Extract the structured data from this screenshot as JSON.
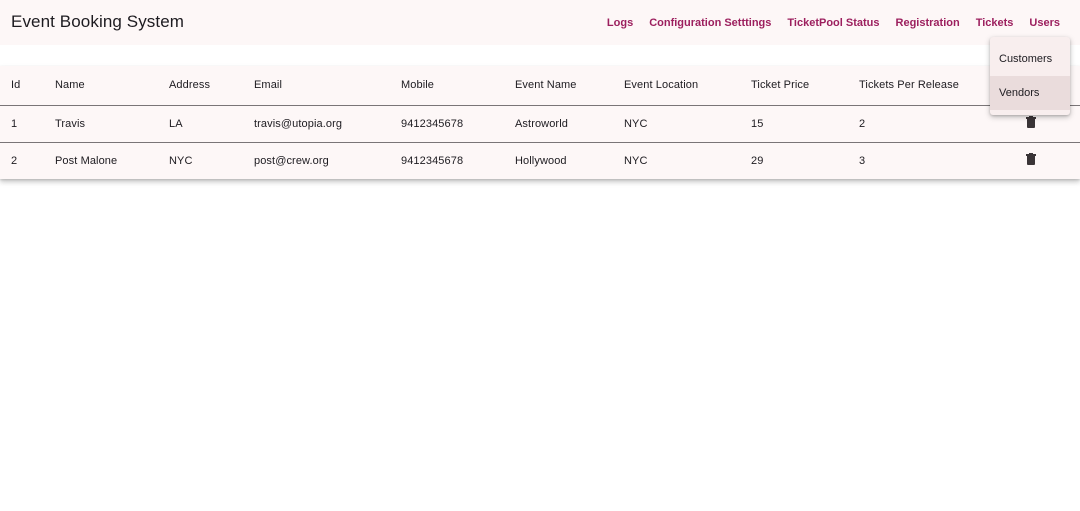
{
  "header": {
    "title": "Event Booking System",
    "nav": [
      {
        "id": "logs",
        "label": "Logs"
      },
      {
        "id": "configuration",
        "label": "Configuration Setttings"
      },
      {
        "id": "ticketpool",
        "label": "TicketPool Status"
      },
      {
        "id": "registration",
        "label": "Registration"
      },
      {
        "id": "tickets",
        "label": "Tickets"
      },
      {
        "id": "users",
        "label": "Users"
      }
    ]
  },
  "users_menu": {
    "items": [
      {
        "label": "Customers"
      },
      {
        "label": "Vendors"
      }
    ],
    "highlighted": "Vendors"
  },
  "table": {
    "columns": [
      "Id",
      "Name",
      "Address",
      "Email",
      "Mobile",
      "Event Name",
      "Event Location",
      "Ticket Price",
      "Tickets Per Release"
    ],
    "rows": [
      {
        "id": "1",
        "name": "Travis",
        "address": "LA",
        "email": "travis@utopia.org",
        "mobile": "9412345678",
        "event_name": "Astroworld",
        "event_location": "NYC",
        "ticket_price": "15",
        "tickets_per_release": "2",
        "action_icon": "delete-icon"
      },
      {
        "id": "2",
        "name": "Post Malone",
        "address": "NYC",
        "email": "post@crew.org",
        "mobile": "9412345678",
        "event_name": "Hollywood",
        "event_location": "NYC",
        "ticket_price": "29",
        "tickets_per_release": "3",
        "action_icon": "delete-icon"
      }
    ]
  },
  "colors": {
    "accent": "#9c1f5e",
    "surface": "#fdf7f7",
    "icon": "#3a3437"
  }
}
